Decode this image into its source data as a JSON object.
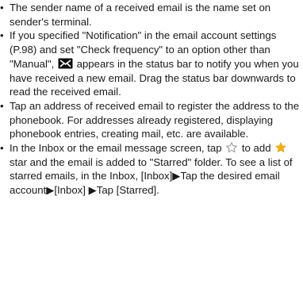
{
  "notes": [
    {
      "text": "The sender name of a received email is the name set on sender's terminal."
    },
    {
      "pre": "If you specified \"Notification\" in the email account settings (P.98) and set \"Check frequency\" to an option other than \"Manual\", ",
      "icon": "new-email-notification-icon",
      "post": " appears in the status bar to notify you when you have received a new email. Drag the status bar downwards to read the received email."
    },
    {
      "text": "Tap an address of received email to register the address to the phonebook. For addresses already registered, displaying phonebook entries, creating mail, etc. are available."
    },
    {
      "pre": "In the Inbox or the email message screen, tap ",
      "icon1": "star-outline-icon",
      "mid": " to add ",
      "icon2": "star-filled-icon",
      "post": " star and the email is added to \"Starred\" folder. To see a list of starred emails, in the Inbox, [Inbox]▶Tap the desired email account▶[Inbox] ▶Tap [Starred]."
    }
  ],
  "colors": {
    "text": "#1a1a1a",
    "email_icon_bg": "#0e0e0e",
    "star_outline": "#9a9a9a",
    "star_filled": "#f5b10c"
  }
}
